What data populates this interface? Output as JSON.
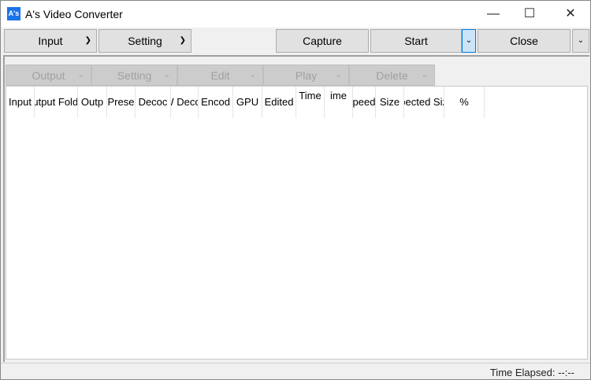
{
  "window": {
    "title": "A's Video Converter",
    "logo": "A's"
  },
  "toolbar": {
    "input": "Input",
    "setting": "Setting",
    "capture": "Capture",
    "start": "Start",
    "close": "Close"
  },
  "subtoolbar": {
    "output": "Output",
    "setting": "Setting",
    "edit": "Edit",
    "play": "Play",
    "delete": "Delete"
  },
  "columns": [
    "Input",
    "Output Folder",
    "Outp",
    "Prese",
    "Decoc",
    "HW Decode",
    "Encod",
    "GPU",
    "Edited",
    "Time",
    "ime",
    "peed",
    "Size",
    "xpected Size",
    "%"
  ],
  "status": {
    "time_elapsed": "Time Elapsed: --:--"
  }
}
